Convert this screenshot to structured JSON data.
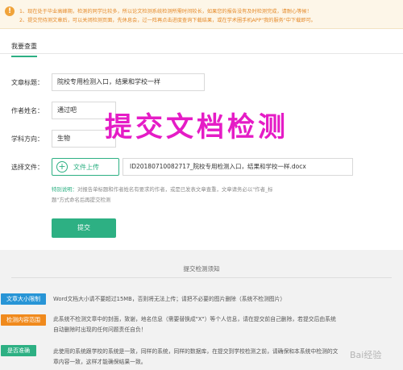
{
  "notice": {
    "line1": "1、现在处于毕业高峰期，检测的同学比较多，所以论文检测系统检测所需时间较长，如果您的报告没有及时检测完成，请耐心等候！",
    "line2": "2、提交完待测文章后，可以关闭检测页面，先休息会，过一阵再点击进度查询下载结果，或在学术圈手机APP\"我的服务\"中下载即可。"
  },
  "section_tab": "我要查重",
  "form": {
    "title_label": "文章标题：",
    "title_value": "院校专用检测入口，结果和学校一样",
    "author_label": "作者姓名：",
    "author_value": "通过吧",
    "subject_label": "学科方向：",
    "subject_value": "生物",
    "file_label": "选择文件：",
    "upload_label": "文件上传",
    "file_name": "ID20180710082717_院校专用检测入口，结果和学校一样.docx",
    "tip_label": "特别说明：",
    "tip_line1": "对报告单标题和作者姓名有要求的作者，或是已发表文章查重，文章请务必以\"作者_标",
    "tip_line2": "题\"方式命名后再提交检测",
    "submit_label": "提交"
  },
  "overlay_title": "提交文档检测",
  "notes": {
    "title": "提交检测须知",
    "items": [
      {
        "badge": "文章大小限制",
        "color": "#2895d6",
        "lines": [
          "Word文档大小请不要超过15MB，否则将无法上传；请把不必要的图片删除（系统不检测图片）"
        ]
      },
      {
        "badge": "检测内容范围",
        "color": "#f08a1d",
        "lines": [
          "此系统不检测文章中的封面，致谢，地名信息（需要替换成\"X\"）等个人信息，请在提交前自己删除，若提交后由系统",
          "自动删除时出现的任何问题责任自负！"
        ]
      },
      {
        "badge": "是否准确",
        "color": "#2db083",
        "lines": [
          "此使用的系统跟学校的系统是一致，同样的系统，同样的数据库，在提交到学校检测之前，请确保和本系统中检测的文",
          "章内容一致，这样才能确保结果一致。"
        ]
      }
    ]
  },
  "watermark": "Bai经验"
}
